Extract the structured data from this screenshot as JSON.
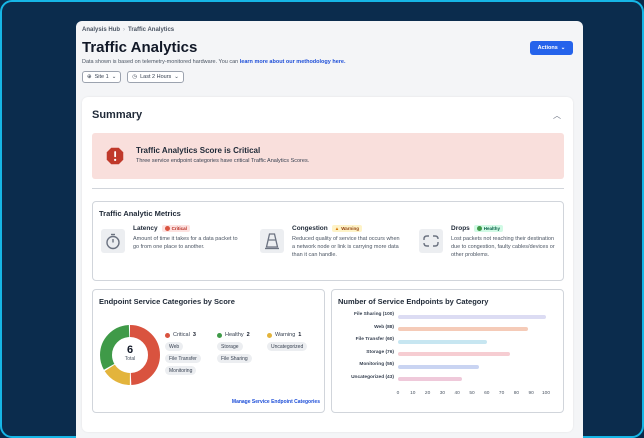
{
  "breadcrumb": [
    "Analysis Hub",
    "Traffic Analytics"
  ],
  "page": {
    "title": "Traffic Analytics",
    "subtitle_prefix": "Data shown is based on telemetry-monitored hardware. You can ",
    "subtitle_link": "learn more about our methodology here.",
    "actions_label": "Actions"
  },
  "filters": {
    "site": "Site 1",
    "time": "Last 2 Hours"
  },
  "summary": {
    "title": "Summary",
    "alert_title": "Traffic Analytics Score is Critical",
    "alert_text": "Three service endpoint categories have critical Traffic Analytics Scores."
  },
  "metrics": {
    "title": "Traffic Analytic Metrics",
    "items": [
      {
        "name": "Latency",
        "status": "Critical",
        "icon": "stopwatch-icon",
        "desc": "Amount of time it takes for a data packet to go from one place to another."
      },
      {
        "name": "Congestion",
        "status": "Warning",
        "icon": "traffic-cone-icon",
        "desc": "Reduced quality of service that occurs when a network node or link is carrying more data than it can handle."
      },
      {
        "name": "Drops",
        "status": "Healthy",
        "icon": "broken-link-icon",
        "desc": "Lost packets not reaching their destination due to congestion, faulty cables/devices or other problems."
      }
    ]
  },
  "endpoint_categories": {
    "title": "Endpoint Service Categories by Score",
    "total": "6",
    "total_label": "Total",
    "groups": [
      {
        "label": "Critical",
        "count": "3",
        "items": [
          "Web",
          "File Transfer",
          "Monitoring"
        ]
      },
      {
        "label": "Healthy",
        "count": "2",
        "items": [
          "Storage",
          "File Sharing"
        ]
      },
      {
        "label": "Warning",
        "count": "1",
        "items": [
          "Uncategorized"
        ]
      }
    ],
    "manage_link": "Manage Service Endpoint Categories"
  },
  "colors": {
    "critical": "#d9533f",
    "healthy": "#3f9a48",
    "warning": "#e3b43c",
    "accent": "#2563eb"
  },
  "chart_data": {
    "type": "bar",
    "title": "Number of Service Endpoints by Category",
    "categories": [
      "File Sharing (100)",
      "Web (88)",
      "File Transfer (60)",
      "Storage (76)",
      "Monitoring (55)",
      "Uncategorized (43)"
    ],
    "values": [
      100,
      88,
      60,
      76,
      55,
      43
    ],
    "colors": [
      "#dcdcf3",
      "#f5cbb8",
      "#c7e6f1",
      "#f6cdd2",
      "#c9d4f2",
      "#efc9da"
    ],
    "xticks": [
      "0",
      "10",
      "20",
      "30",
      "40",
      "50",
      "60",
      "70",
      "80",
      "90",
      "100"
    ],
    "xlim": [
      0,
      100
    ],
    "orientation": "horizontal"
  }
}
